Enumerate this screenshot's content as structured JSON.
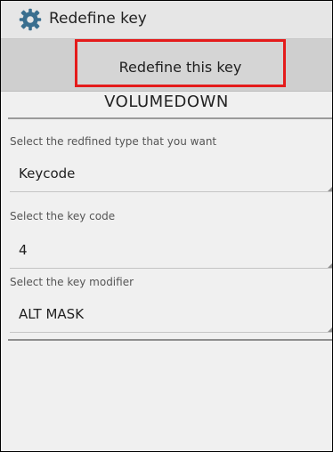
{
  "window": {
    "title": "Redefine key",
    "settings_icon": "gear-icon"
  },
  "action": {
    "redefine_label": "Redefine this key",
    "highlight_color": "#e41b1b"
  },
  "key": {
    "name": "VOLUMEDOWN"
  },
  "fields": [
    {
      "label": "Select the redfined type that you want",
      "value": "Keycode"
    },
    {
      "label": "Select the key code",
      "value": "4"
    },
    {
      "label": "Select the key modifier",
      "value": "ALT MASK"
    }
  ]
}
